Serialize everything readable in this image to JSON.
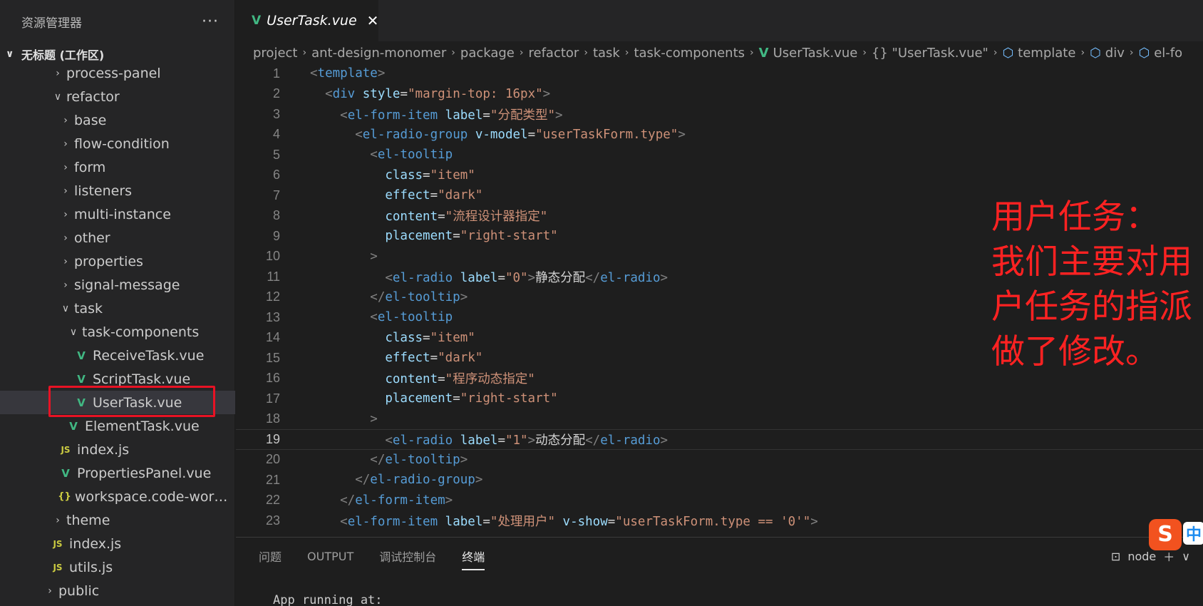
{
  "sidebar": {
    "title": "资源管理器",
    "more": "···",
    "workspace": "无标题 (工作区)",
    "tree": [
      {
        "label": "process-panel",
        "type": "folder",
        "open": false,
        "depth": 2
      },
      {
        "label": "refactor",
        "type": "folder",
        "open": true,
        "depth": 2
      },
      {
        "label": "base",
        "type": "folder",
        "open": false,
        "depth": 3
      },
      {
        "label": "flow-condition",
        "type": "folder",
        "open": false,
        "depth": 3
      },
      {
        "label": "form",
        "type": "folder",
        "open": false,
        "depth": 3
      },
      {
        "label": "listeners",
        "type": "folder",
        "open": false,
        "depth": 3
      },
      {
        "label": "multi-instance",
        "type": "folder",
        "open": false,
        "depth": 3
      },
      {
        "label": "other",
        "type": "folder",
        "open": false,
        "depth": 3
      },
      {
        "label": "properties",
        "type": "folder",
        "open": false,
        "depth": 3
      },
      {
        "label": "signal-message",
        "type": "folder",
        "open": false,
        "depth": 3
      },
      {
        "label": "task",
        "type": "folder",
        "open": true,
        "depth": 3
      },
      {
        "label": "task-components",
        "type": "folder",
        "open": true,
        "depth": 4
      },
      {
        "label": "ReceiveTask.vue",
        "type": "vue",
        "depth": 5
      },
      {
        "label": "ScriptTask.vue",
        "type": "vue",
        "depth": 5
      },
      {
        "label": "UserTask.vue",
        "type": "vue",
        "depth": 5,
        "active": true
      },
      {
        "label": "ElementTask.vue",
        "type": "vue",
        "depth": 4
      },
      {
        "label": "index.js",
        "type": "js",
        "depth": 3
      },
      {
        "label": "PropertiesPanel.vue",
        "type": "vue",
        "depth": 3
      },
      {
        "label": "workspace.code-workspa...",
        "type": "json",
        "depth": 3
      },
      {
        "label": "theme",
        "type": "folder",
        "open": false,
        "depth": 2
      },
      {
        "label": "index.js",
        "type": "js",
        "depth": 2
      },
      {
        "label": "utils.js",
        "type": "js",
        "depth": 2
      },
      {
        "label": "public",
        "type": "folder",
        "open": false,
        "depth": 1
      }
    ]
  },
  "editor": {
    "tab_label": "UserTask.vue",
    "breadcrumb": [
      "project",
      "ant-design-monomer",
      "package",
      "refactor",
      "task",
      "task-components",
      "UserTask.vue",
      "{} \"UserTask.vue\"",
      "template",
      "div",
      "el-fo"
    ],
    "current_line": 19,
    "lines": [
      [
        [
          "t",
          "<"
        ],
        [
          "n",
          "template"
        ],
        [
          "t",
          ">"
        ]
      ],
      [
        [
          "t",
          "  <"
        ],
        [
          "n",
          "div"
        ],
        [
          "w",
          " "
        ],
        [
          "a",
          "style"
        ],
        [
          "w",
          "="
        ],
        [
          "s",
          "\"margin-top: 16px\""
        ],
        [
          "t",
          ">"
        ]
      ],
      [
        [
          "t",
          "    <"
        ],
        [
          "n",
          "el-form-item"
        ],
        [
          "w",
          " "
        ],
        [
          "a",
          "label"
        ],
        [
          "w",
          "="
        ],
        [
          "s",
          "\"分配类型\""
        ],
        [
          "t",
          ">"
        ]
      ],
      [
        [
          "t",
          "      <"
        ],
        [
          "n",
          "el-radio-group"
        ],
        [
          "w",
          " "
        ],
        [
          "a",
          "v-model"
        ],
        [
          "w",
          "="
        ],
        [
          "s",
          "\"userTaskForm.type\""
        ],
        [
          "t",
          ">"
        ]
      ],
      [
        [
          "t",
          "        <"
        ],
        [
          "n",
          "el-tooltip"
        ]
      ],
      [
        [
          "w",
          "          "
        ],
        [
          "a",
          "class"
        ],
        [
          "w",
          "="
        ],
        [
          "s",
          "\"item\""
        ]
      ],
      [
        [
          "w",
          "          "
        ],
        [
          "a",
          "effect"
        ],
        [
          "w",
          "="
        ],
        [
          "s",
          "\"dark\""
        ]
      ],
      [
        [
          "w",
          "          "
        ],
        [
          "a",
          "content"
        ],
        [
          "w",
          "="
        ],
        [
          "s",
          "\"流程设计器指定\""
        ]
      ],
      [
        [
          "w",
          "          "
        ],
        [
          "a",
          "placement"
        ],
        [
          "w",
          "="
        ],
        [
          "s",
          "\"right-start\""
        ]
      ],
      [
        [
          "t",
          "        >"
        ]
      ],
      [
        [
          "t",
          "          <"
        ],
        [
          "n",
          "el-radio"
        ],
        [
          "w",
          " "
        ],
        [
          "a",
          "label"
        ],
        [
          "w",
          "="
        ],
        [
          "s",
          "\"0\""
        ],
        [
          "t",
          ">"
        ],
        [
          "w",
          "静态分配"
        ],
        [
          "t",
          "</"
        ],
        [
          "n",
          "el-radio"
        ],
        [
          "t",
          ">"
        ]
      ],
      [
        [
          "t",
          "        </"
        ],
        [
          "n",
          "el-tooltip"
        ],
        [
          "t",
          ">"
        ]
      ],
      [
        [
          "t",
          "        <"
        ],
        [
          "n",
          "el-tooltip"
        ]
      ],
      [
        [
          "w",
          "          "
        ],
        [
          "a",
          "class"
        ],
        [
          "w",
          "="
        ],
        [
          "s",
          "\"item\""
        ]
      ],
      [
        [
          "w",
          "          "
        ],
        [
          "a",
          "effect"
        ],
        [
          "w",
          "="
        ],
        [
          "s",
          "\"dark\""
        ]
      ],
      [
        [
          "w",
          "          "
        ],
        [
          "a",
          "content"
        ],
        [
          "w",
          "="
        ],
        [
          "s",
          "\"程序动态指定\""
        ]
      ],
      [
        [
          "w",
          "          "
        ],
        [
          "a",
          "placement"
        ],
        [
          "w",
          "="
        ],
        [
          "s",
          "\"right-start\""
        ]
      ],
      [
        [
          "t",
          "        >"
        ]
      ],
      [
        [
          "t",
          "          <"
        ],
        [
          "n",
          "el-radio"
        ],
        [
          "w",
          " "
        ],
        [
          "a",
          "label"
        ],
        [
          "w",
          "="
        ],
        [
          "s",
          "\"1\""
        ],
        [
          "t",
          ">"
        ],
        [
          "w",
          "动态分配"
        ],
        [
          "t",
          "</"
        ],
        [
          "n",
          "el-radio"
        ],
        [
          "t",
          ">"
        ]
      ],
      [
        [
          "t",
          "        </"
        ],
        [
          "n",
          "el-tooltip"
        ],
        [
          "t",
          ">"
        ]
      ],
      [
        [
          "t",
          "      </"
        ],
        [
          "n",
          "el-radio-group"
        ],
        [
          "t",
          ">"
        ]
      ],
      [
        [
          "t",
          "    </"
        ],
        [
          "n",
          "el-form-item"
        ],
        [
          "t",
          ">"
        ]
      ],
      [
        [
          "t",
          "    <"
        ],
        [
          "n",
          "el-form-item"
        ],
        [
          "w",
          " "
        ],
        [
          "a",
          "label"
        ],
        [
          "w",
          "="
        ],
        [
          "s",
          "\"处理用户\""
        ],
        [
          "w",
          " "
        ],
        [
          "a",
          "v-show"
        ],
        [
          "w",
          "="
        ],
        [
          "s",
          "\"userTaskForm.type == '0'\""
        ],
        [
          "t",
          ">"
        ]
      ]
    ],
    "annotation": [
      "用户任务：",
      "我们主要对用户任务的指派",
      "做了修改。"
    ]
  },
  "panel": {
    "tabs": [
      "问题",
      "OUTPUT",
      "调试控制台",
      "终端"
    ],
    "active_tab": "终端",
    "terminal_name": "node",
    "terminal_line": "App running at:"
  },
  "ime": {
    "logo": "S",
    "label": "中"
  },
  "colors": {
    "accent_red": "#ff2222",
    "vue_green": "#41b883"
  }
}
